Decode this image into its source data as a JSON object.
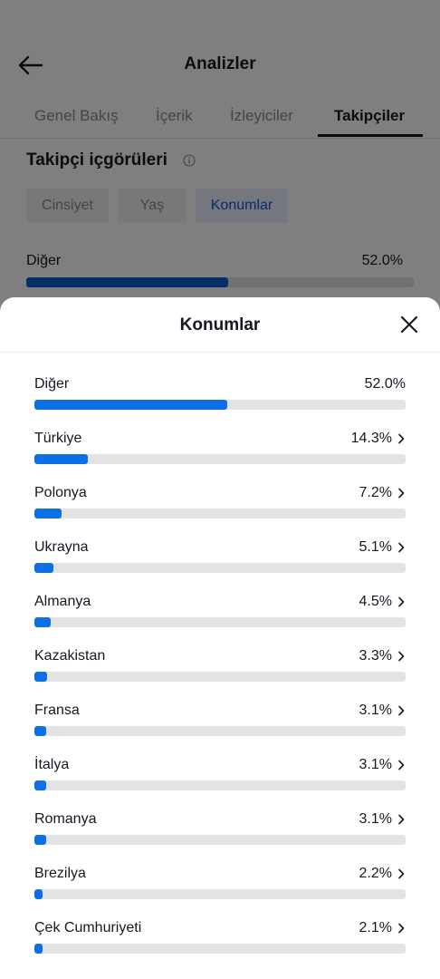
{
  "header": {
    "title": "Analizler",
    "back_icon": "arrow-left-icon"
  },
  "tabs": [
    {
      "label": "Genel Bakış",
      "active": false
    },
    {
      "label": "İçerik",
      "active": false
    },
    {
      "label": "İzleyiciler",
      "active": false
    },
    {
      "label": "Takipçiler",
      "active": true
    }
  ],
  "insights": {
    "title": "Takipçi içgörüleri",
    "info_icon": "info-icon",
    "chips": [
      {
        "label": "Cinsiyet",
        "active": false
      },
      {
        "label": "Yaş",
        "active": false
      },
      {
        "label": "Konumlar",
        "active": true
      }
    ],
    "preview_row": {
      "label": "Diğer",
      "pct": "52.0%",
      "value": 52.0
    }
  },
  "sheet": {
    "title": "Konumlar",
    "close_icon": "close-icon",
    "chevron_icon": "chevron-right-icon",
    "locations": [
      {
        "label": "Diğer",
        "pct": "52.0%",
        "value": 52.0,
        "chevron": false
      },
      {
        "label": "Türkiye",
        "pct": "14.3%",
        "value": 14.3,
        "chevron": true
      },
      {
        "label": "Polonya",
        "pct": "7.2%",
        "value": 7.2,
        "chevron": true
      },
      {
        "label": "Ukrayna",
        "pct": "5.1%",
        "value": 5.1,
        "chevron": true
      },
      {
        "label": "Almanya",
        "pct": "4.5%",
        "value": 4.5,
        "chevron": true
      },
      {
        "label": "Kazakistan",
        "pct": "3.3%",
        "value": 3.3,
        "chevron": true
      },
      {
        "label": "Fransa",
        "pct": "3.1%",
        "value": 3.1,
        "chevron": true
      },
      {
        "label": "İtalya",
        "pct": "3.1%",
        "value": 3.1,
        "chevron": true
      },
      {
        "label": "Romanya",
        "pct": "3.1%",
        "value": 3.1,
        "chevron": true
      },
      {
        "label": "Brezilya",
        "pct": "2.2%",
        "value": 2.2,
        "chevron": true
      },
      {
        "label": "Çek Cumhuriyeti",
        "pct": "2.1%",
        "value": 2.1,
        "chevron": true
      }
    ]
  },
  "colors": {
    "accent": "#0e6ee6",
    "accent_dark": "#0b5bd3",
    "track": "#e3e3e4",
    "overlay": "rgba(0,0,0,0.5)"
  }
}
